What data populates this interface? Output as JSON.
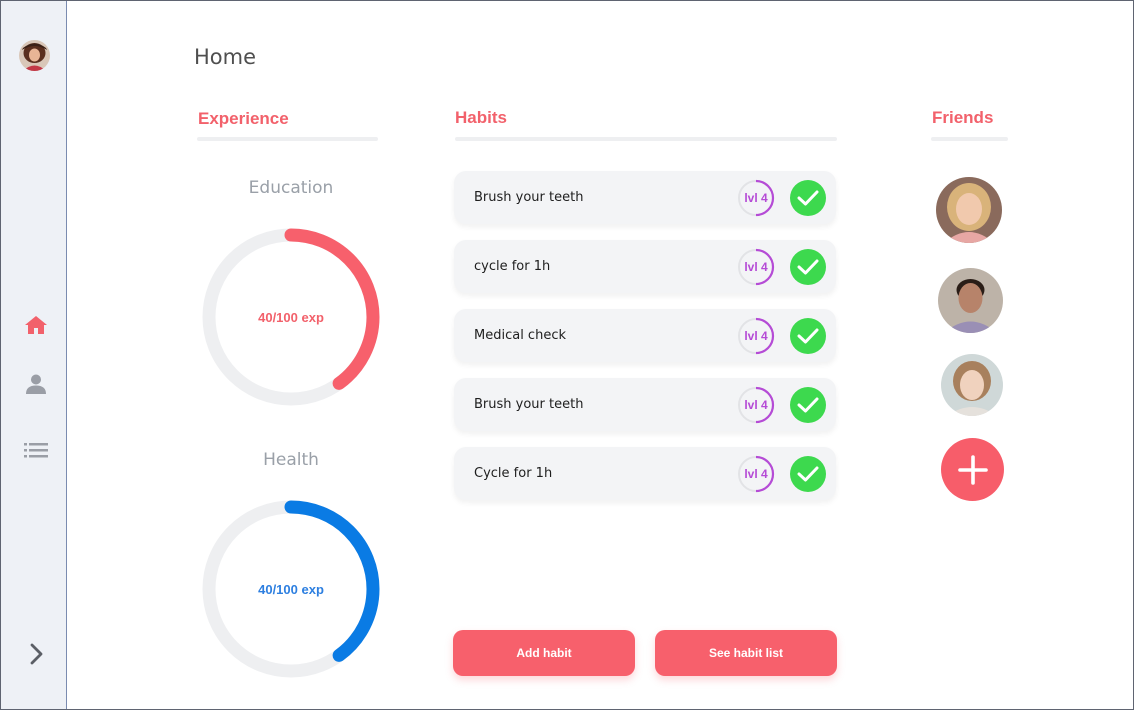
{
  "page": {
    "title": "Home"
  },
  "sidebar": {
    "avatar": "user-avatar",
    "nav": [
      {
        "icon": "home-icon",
        "active": true
      },
      {
        "icon": "user-icon",
        "active": false
      },
      {
        "icon": "list-icon",
        "active": false
      }
    ],
    "expand_icon": "chevron-right-icon"
  },
  "experience": {
    "heading": "Experience",
    "items": [
      {
        "label": "Education",
        "value_text": "40/100 exp",
        "progress": 0.4,
        "color": "#f7606c"
      },
      {
        "label": "Health",
        "value_text": "40/100 exp",
        "progress": 0.4,
        "color": "#0a7be4"
      }
    ]
  },
  "habits": {
    "heading": "Habits",
    "items": [
      {
        "name": "Brush your teeth",
        "level": "lvl 4",
        "done": true
      },
      {
        "name": "cycle for 1h",
        "level": "lvl 4",
        "done": true
      },
      {
        "name": "Medical check",
        "level": "lvl 4",
        "done": true
      },
      {
        "name": "Brush your teeth",
        "level": "lvl 4",
        "done": true
      },
      {
        "name": "Cycle for 1h",
        "level": "lvl 4",
        "done": true
      }
    ],
    "add_label": "Add habit",
    "list_label": "See habit list"
  },
  "friends": {
    "heading": "Friends",
    "add_icon": "plus-icon"
  },
  "colors": {
    "accent": "#f7606c",
    "health": "#0a7be4",
    "level": "#b54bd6",
    "check": "#3dd94e"
  }
}
